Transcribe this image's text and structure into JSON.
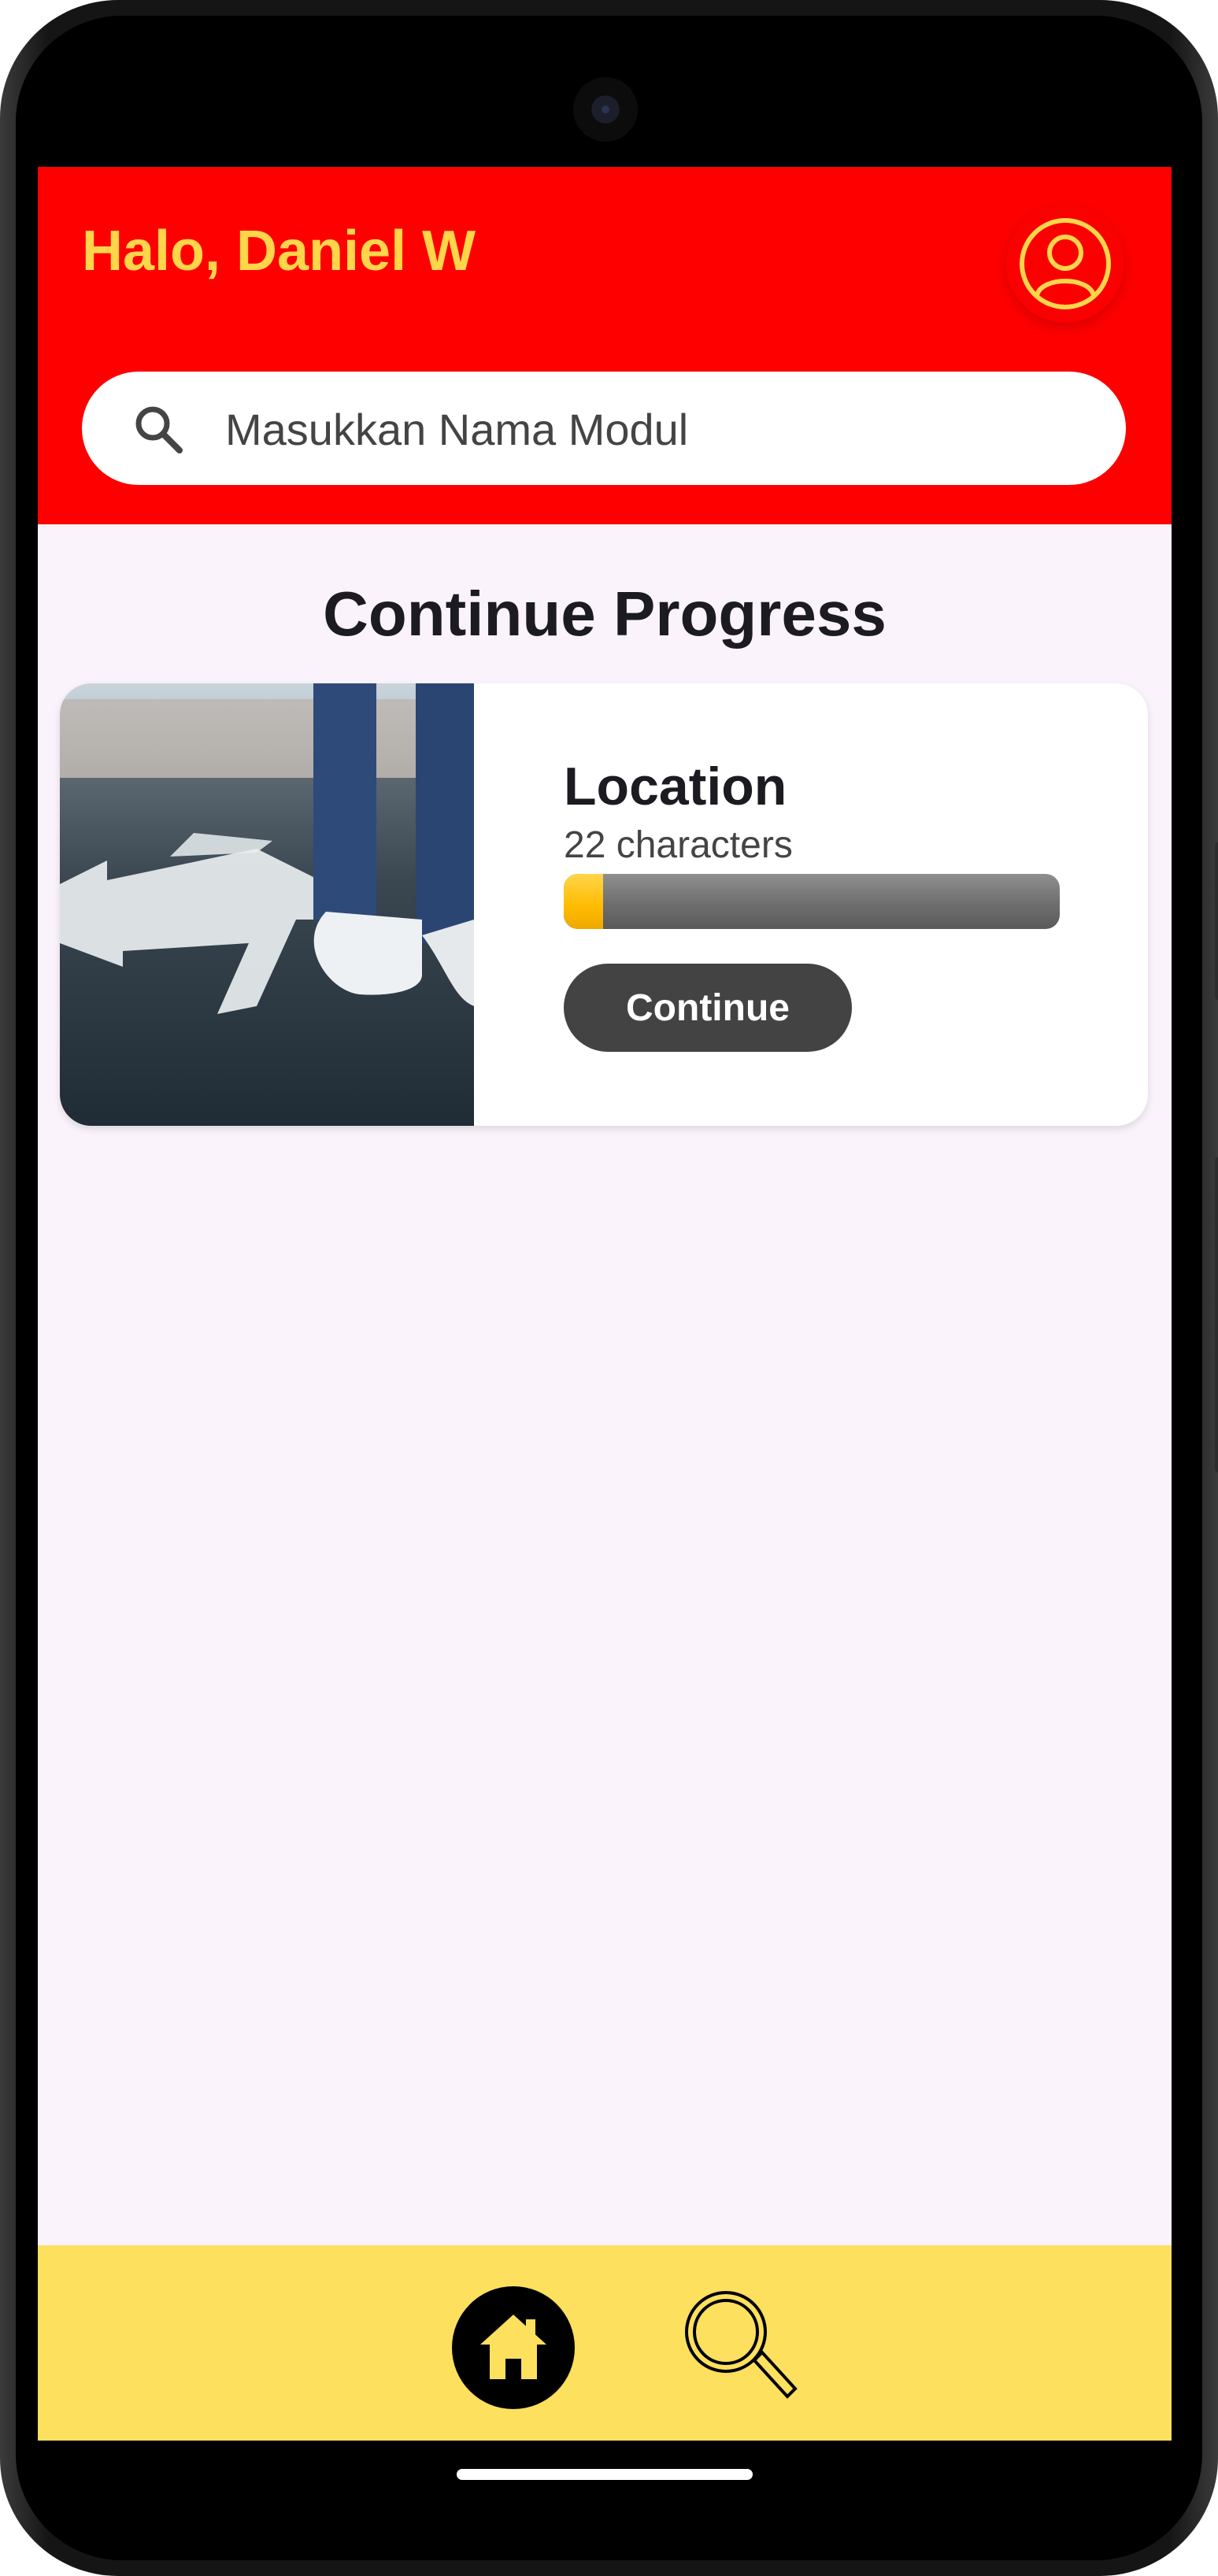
{
  "header": {
    "greeting": "Halo, Daniel W",
    "profile_icon": "user-circle-icon",
    "background_color": "#fe0000",
    "accent_color": "#ffd54a"
  },
  "search": {
    "placeholder": "Masukkan Nama Modul",
    "icon": "search-icon"
  },
  "main": {
    "section_title": "Continue Progress",
    "cards": [
      {
        "title": "Location",
        "subtitle": "22 characters",
        "progress": 0.08,
        "button_label": "Continue",
        "image": "feet-on-road-arrows-photo"
      }
    ]
  },
  "bottom_nav": {
    "items": [
      {
        "name": "home",
        "icon": "home-icon",
        "active": true
      },
      {
        "name": "search",
        "icon": "search-icon",
        "active": false
      }
    ],
    "background_color": "#fde05e"
  }
}
